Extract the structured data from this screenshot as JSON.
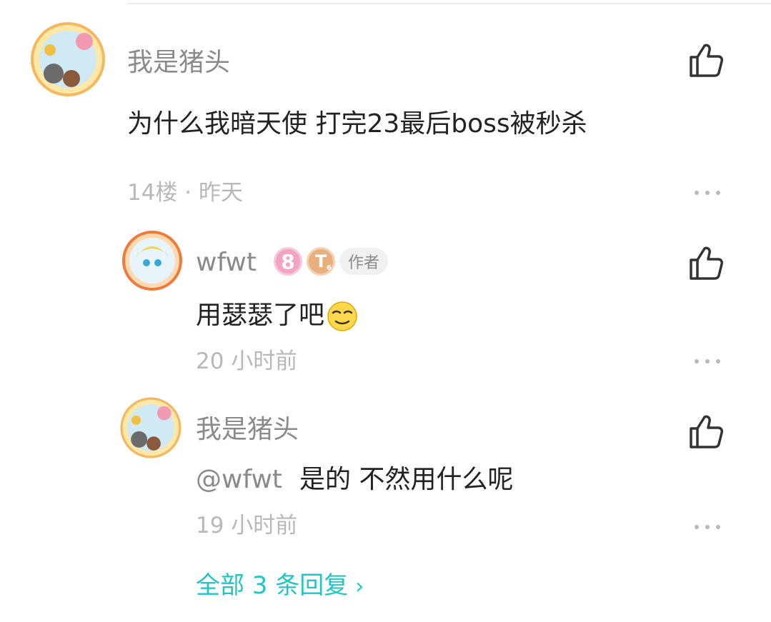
{
  "comments": [
    {
      "username": "我是猪头",
      "content": "为什么我暗天使 打完23最后boss被秒杀",
      "meta": "14楼 · 昨天"
    }
  ],
  "replies": [
    {
      "username": "wfwt",
      "level_badge": "8",
      "rank_badge": "T",
      "rank_sub": "6",
      "author_tag": "作者",
      "content": "用瑟瑟了吧",
      "emoji": "smirk-emoji",
      "meta": "20 小时前"
    },
    {
      "username": "我是猪头",
      "mention": "@wfwt",
      "content": "是的 不然用什么呢",
      "meta": "19 小时前"
    }
  ],
  "view_all_label": "全部 3 条回复",
  "colors": {
    "accent": "#22c5c5",
    "username": "#8a8a8a",
    "meta": "#b8b8b8",
    "text": "#222222"
  }
}
